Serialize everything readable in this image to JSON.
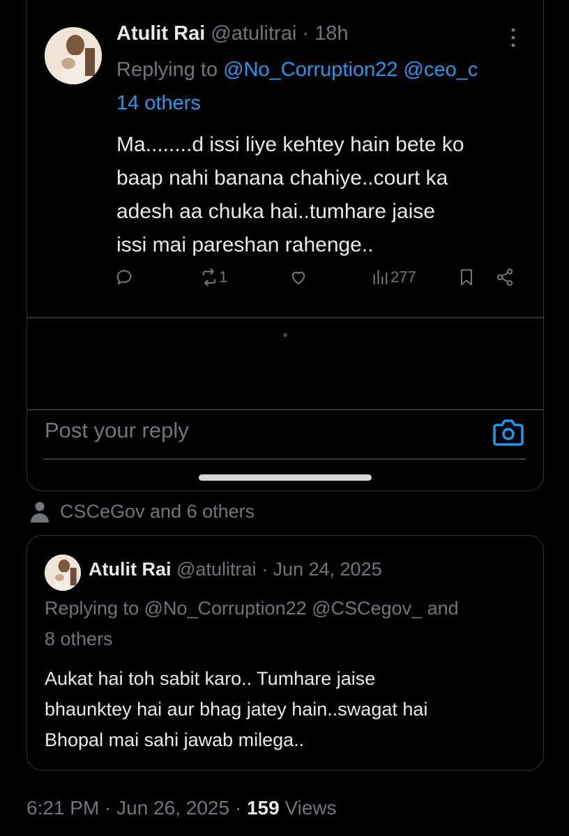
{
  "reply_tweet": {
    "author_name": "Atulit Rai",
    "author_handle": "@atulitrai",
    "separator": " · ",
    "time": "18h",
    "replying_prefix": "Replying to ",
    "replying_to_1": "@No_Corruption22",
    "replying_to_2": "@ceo_c",
    "replying_more": "14 others",
    "text_lines": [
      "Ma........d issi liye kehtey hain bete ko",
      "baap nahi banana chahiye..court ka",
      "adesh aa chuka hai..tumhare jaise",
      "issi mai pareshan rahenge.."
    ],
    "retweet_count": "1",
    "view_count": "277"
  },
  "reply_box": {
    "placeholder": "Post your reply"
  },
  "social_context": "CSCeGov and 6 others",
  "quoted_tweet": {
    "author_name": "Atulit Rai",
    "author_handle": "@atulitrai",
    "separator": " · ",
    "date": "Jun 24, 2025",
    "replying_line_1": "Replying to @No_Corruption22 @CSCegov_ and",
    "replying_line_2": "8 others",
    "text_lines": [
      "Aukat hai toh sabit karo.. Tumhare jaise",
      "bhaunktey hai aur bhag jatey hain..swagat hai",
      "Bhopal mai sahi jawab milega.."
    ]
  },
  "post_meta": {
    "timestamp": "6:21 PM · Jun 26, 2025 · ",
    "views_count": "159",
    "views_label": " Views"
  },
  "colors": {
    "background": "#000000",
    "text": "#e7e9ea",
    "muted": "#71767b",
    "link": "#1d9bf0",
    "border": "#2f3336"
  },
  "icons": [
    "more-vertical-icon",
    "reply-icon",
    "retweet-icon",
    "like-icon",
    "views-icon",
    "bookmark-icon",
    "share-icon",
    "camera-icon",
    "person-icon"
  ]
}
